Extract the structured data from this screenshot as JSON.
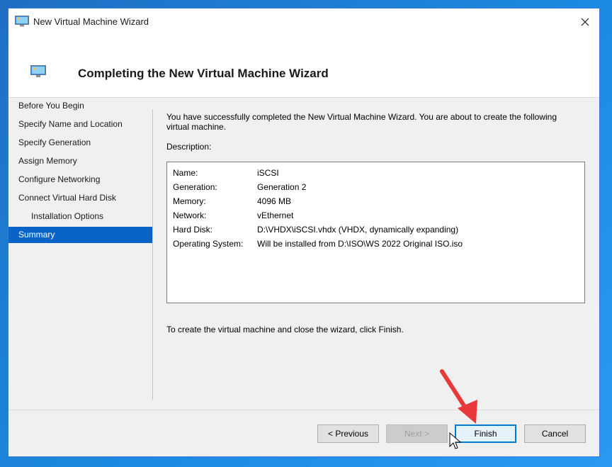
{
  "window": {
    "title": "New Virtual Machine Wizard",
    "heading": "Completing the New Virtual Machine Wizard"
  },
  "nav": {
    "items": [
      {
        "label": "Before You Begin"
      },
      {
        "label": "Specify Name and Location"
      },
      {
        "label": "Specify Generation"
      },
      {
        "label": "Assign Memory"
      },
      {
        "label": "Configure Networking"
      },
      {
        "label": "Connect Virtual Hard Disk"
      },
      {
        "label": "Installation Options"
      },
      {
        "label": "Summary"
      }
    ]
  },
  "content": {
    "intro": "You have successfully completed the New Virtual Machine Wizard. You are about to create the following virtual machine.",
    "description_label": "Description:",
    "rows": [
      {
        "key": "Name:",
        "value": "iSCSI"
      },
      {
        "key": "Generation:",
        "value": "Generation 2"
      },
      {
        "key": "Memory:",
        "value": "4096 MB"
      },
      {
        "key": "Network:",
        "value": "vEthernet"
      },
      {
        "key": "Hard Disk:",
        "value": "D:\\VHDX\\iSCSI.vhdx (VHDX, dynamically expanding)"
      },
      {
        "key": "Operating System:",
        "value": "Will be installed from D:\\ISO\\WS 2022 Original ISO.iso"
      }
    ],
    "finish_note": "To create the virtual machine and close the wizard, click Finish."
  },
  "buttons": {
    "previous": "< Previous",
    "next": "Next >",
    "finish": "Finish",
    "cancel": "Cancel"
  },
  "colors": {
    "accent": "#0a64c8",
    "annotation_arrow": "#e8393a"
  },
  "icons": {
    "title": "monitor-icon",
    "header": "monitor-icon",
    "close": "close-icon",
    "cursor": "mouse-pointer-icon",
    "annotation": "red-arrow-icon"
  }
}
